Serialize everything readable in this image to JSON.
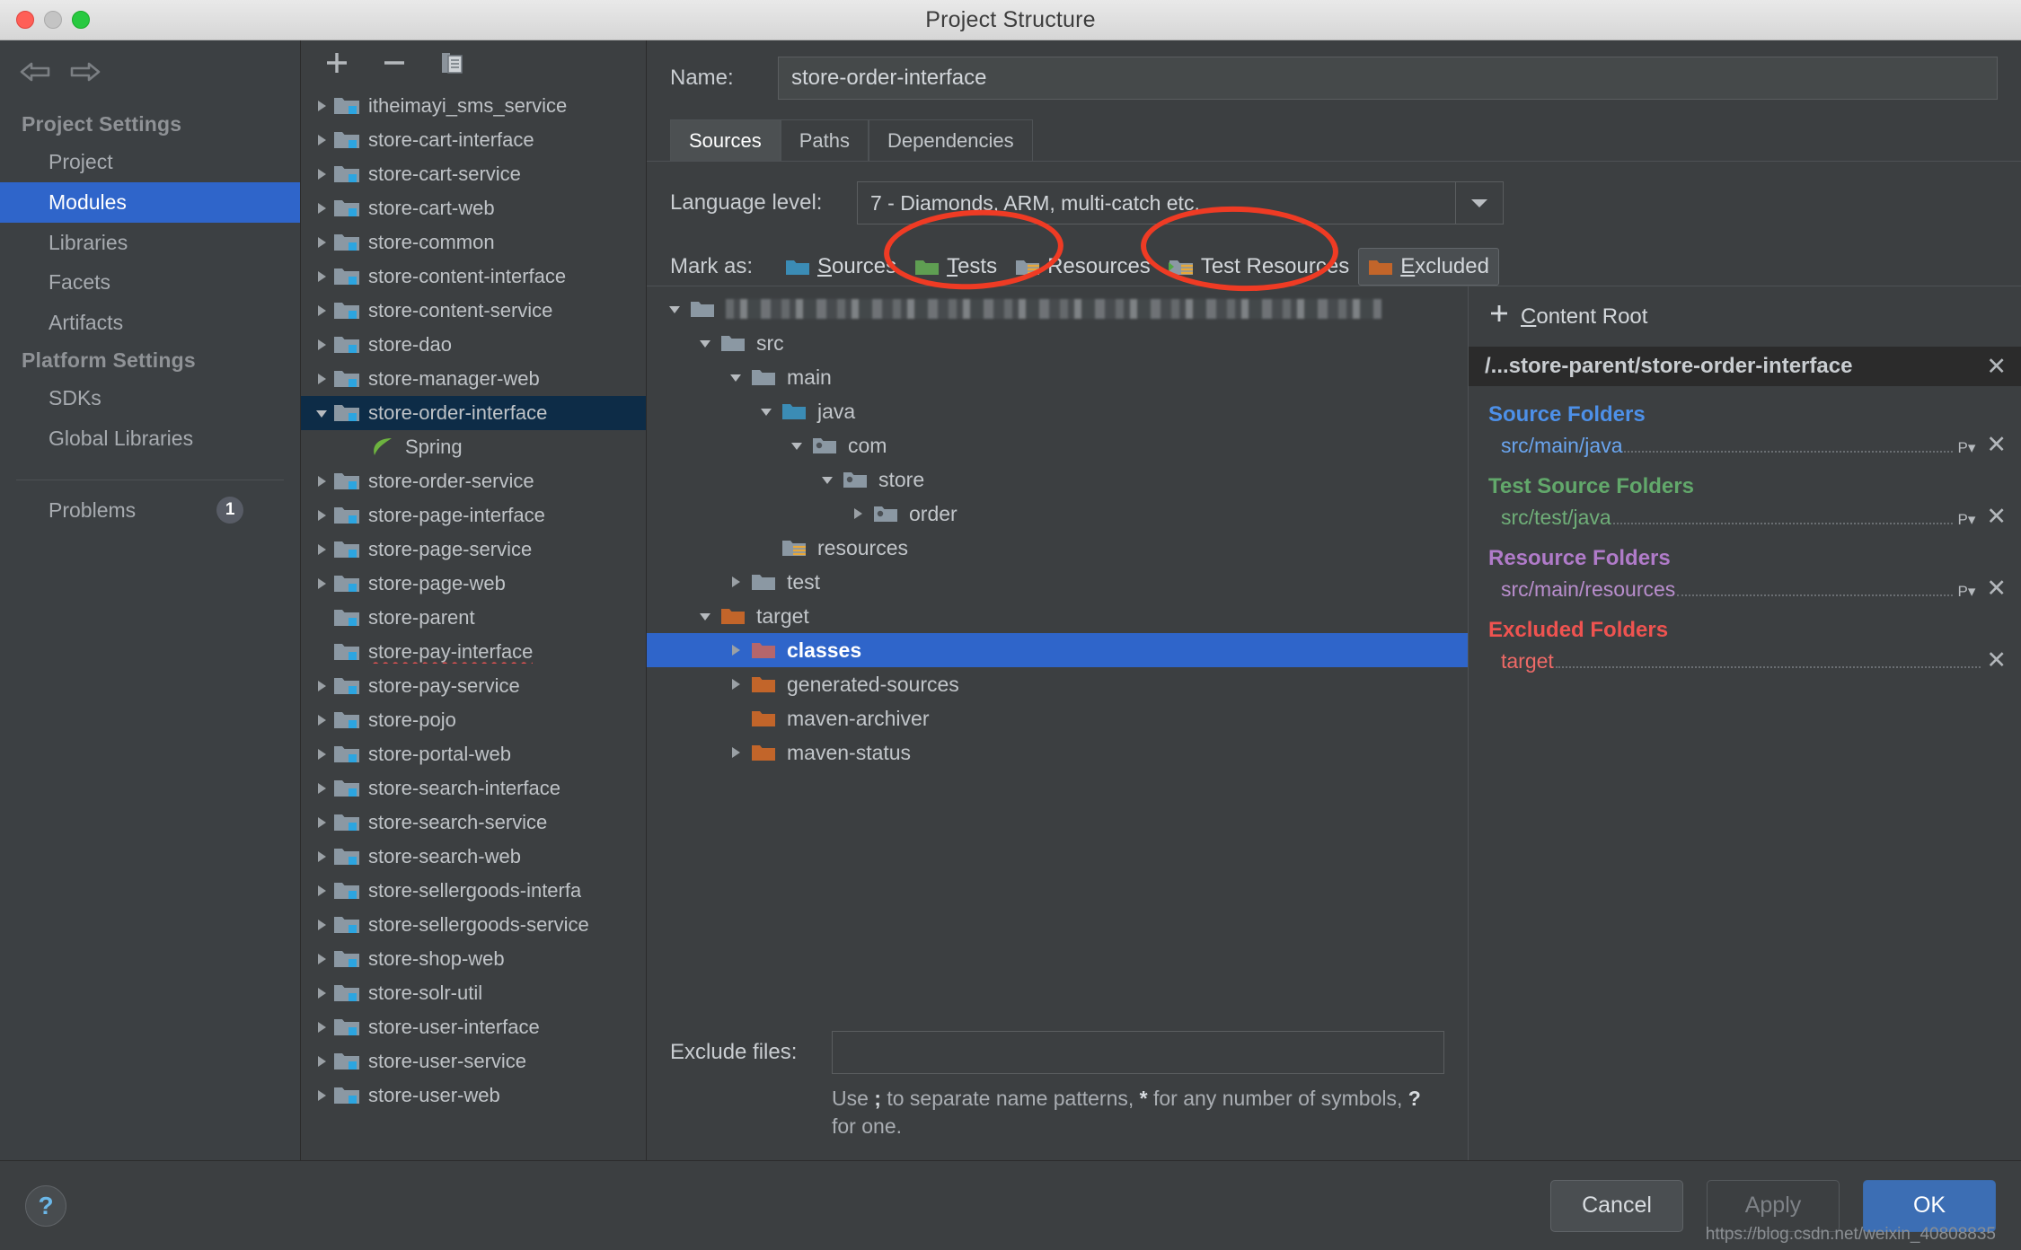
{
  "window": {
    "title": "Project Structure",
    "traffic_lights": [
      "close",
      "minimize",
      "maximize"
    ]
  },
  "sidebar": {
    "nav_back_icon": "arrow-left-icon",
    "nav_forward_icon": "arrow-right-icon",
    "sections": [
      {
        "header": "Project Settings",
        "items": [
          {
            "label": "Project",
            "selected": false
          },
          {
            "label": "Modules",
            "selected": true
          },
          {
            "label": "Libraries",
            "selected": false
          },
          {
            "label": "Facets",
            "selected": false
          },
          {
            "label": "Artifacts",
            "selected": false
          }
        ]
      },
      {
        "header": "Platform Settings",
        "items": [
          {
            "label": "SDKs",
            "selected": false
          },
          {
            "label": "Global Libraries",
            "selected": false
          }
        ]
      }
    ],
    "problems": {
      "label": "Problems",
      "count": "1"
    }
  },
  "modules_panel": {
    "toolbar": [
      {
        "name": "add-module-button",
        "icon": "plus-icon"
      },
      {
        "name": "remove-module-button",
        "icon": "minus-icon"
      },
      {
        "name": "copy-module-button",
        "icon": "copy-icon"
      }
    ],
    "items": [
      {
        "label": "itheimayi_sms_service",
        "expandable": true,
        "expanded": false,
        "selected": false
      },
      {
        "label": "store-cart-interface",
        "expandable": true,
        "expanded": false,
        "selected": false
      },
      {
        "label": "store-cart-service",
        "expandable": true,
        "expanded": false,
        "selected": false
      },
      {
        "label": "store-cart-web",
        "expandable": true,
        "expanded": false,
        "selected": false
      },
      {
        "label": "store-common",
        "expandable": true,
        "expanded": false,
        "selected": false
      },
      {
        "label": "store-content-interface",
        "expandable": true,
        "expanded": false,
        "selected": false
      },
      {
        "label": "store-content-service",
        "expandable": true,
        "expanded": false,
        "selected": false
      },
      {
        "label": "store-dao",
        "expandable": true,
        "expanded": false,
        "selected": false
      },
      {
        "label": "store-manager-web",
        "expandable": true,
        "expanded": false,
        "selected": false
      },
      {
        "label": "store-order-interface",
        "expandable": true,
        "expanded": true,
        "selected": true
      },
      {
        "label": "Spring",
        "facet": true,
        "selected": false
      },
      {
        "label": "store-order-service",
        "expandable": true,
        "expanded": false,
        "selected": false
      },
      {
        "label": "store-page-interface",
        "expandable": true,
        "expanded": false,
        "selected": false
      },
      {
        "label": "store-page-service",
        "expandable": true,
        "expanded": false,
        "selected": false
      },
      {
        "label": "store-page-web",
        "expandable": true,
        "expanded": false,
        "selected": false
      },
      {
        "label": "store-parent",
        "expandable": false,
        "expanded": false,
        "selected": false
      },
      {
        "label": "store-pay-interface",
        "expandable": false,
        "expanded": false,
        "selected": false,
        "error": true
      },
      {
        "label": "store-pay-service",
        "expandable": true,
        "expanded": false,
        "selected": false
      },
      {
        "label": "store-pojo",
        "expandable": true,
        "expanded": false,
        "selected": false
      },
      {
        "label": "store-portal-web",
        "expandable": true,
        "expanded": false,
        "selected": false
      },
      {
        "label": "store-search-interface",
        "expandable": true,
        "expanded": false,
        "selected": false
      },
      {
        "label": "store-search-service",
        "expandable": true,
        "expanded": false,
        "selected": false
      },
      {
        "label": "store-search-web",
        "expandable": true,
        "expanded": false,
        "selected": false
      },
      {
        "label": "store-sellergoods-interfa",
        "expandable": true,
        "expanded": false,
        "selected": false
      },
      {
        "label": "store-sellergoods-service",
        "expandable": true,
        "expanded": false,
        "selected": false
      },
      {
        "label": "store-shop-web",
        "expandable": true,
        "expanded": false,
        "selected": false
      },
      {
        "label": "store-solr-util",
        "expandable": true,
        "expanded": false,
        "selected": false
      },
      {
        "label": "store-user-interface",
        "expandable": true,
        "expanded": false,
        "selected": false
      },
      {
        "label": "store-user-service",
        "expandable": true,
        "expanded": false,
        "selected": false
      },
      {
        "label": "store-user-web",
        "expandable": true,
        "expanded": false,
        "selected": false
      }
    ]
  },
  "detail": {
    "name_label": "Name:",
    "name_value": "store-order-interface",
    "tabs": [
      {
        "label": "Sources",
        "active": true
      },
      {
        "label": "Paths",
        "active": false
      },
      {
        "label": "Dependencies",
        "active": false
      }
    ],
    "language_level_label": "Language level:",
    "language_level_value": "7 - Diamonds, ARM, multi-catch etc.",
    "mark_as_label": "Mark as:",
    "mark_as_buttons": [
      {
        "label": "Sources",
        "mnemonic": "S",
        "color": "#3b8cb5",
        "kind": "sources",
        "highlighted": true
      },
      {
        "label": "Tests",
        "mnemonic": "T",
        "color": "#5f9e52",
        "kind": "tests",
        "highlighted": false
      },
      {
        "label": "Resources",
        "mnemonic": "",
        "color": "#8b98a3",
        "kind": "resources",
        "highlighted": true
      },
      {
        "label": "Test Resources",
        "mnemonic": "",
        "color": "#8b98a3",
        "kind": "test-resources",
        "highlighted": false
      },
      {
        "label": "Excluded",
        "mnemonic": "E",
        "color": "#c2652a",
        "kind": "excluded",
        "boxed": true
      }
    ],
    "tree": [
      {
        "label": "",
        "depth": 0,
        "arrow": "down",
        "folder": "plain",
        "blurred": true
      },
      {
        "label": "src",
        "depth": 1,
        "arrow": "down",
        "folder": "plain"
      },
      {
        "label": "main",
        "depth": 2,
        "arrow": "down",
        "folder": "plain"
      },
      {
        "label": "java",
        "depth": 3,
        "arrow": "down",
        "folder": "source"
      },
      {
        "label": "com",
        "depth": 4,
        "arrow": "down",
        "folder": "package"
      },
      {
        "label": "store",
        "depth": 5,
        "arrow": "down",
        "folder": "package"
      },
      {
        "label": "order",
        "depth": 6,
        "arrow": "right",
        "folder": "package"
      },
      {
        "label": "resources",
        "depth": 3,
        "arrow": "none",
        "folder": "resource"
      },
      {
        "label": "test",
        "depth": 2,
        "arrow": "right",
        "folder": "plain"
      },
      {
        "label": "target",
        "depth": 1,
        "arrow": "down",
        "folder": "excluded"
      },
      {
        "label": "classes",
        "depth": 2,
        "arrow": "right",
        "folder": "excluded-sel",
        "selected": true
      },
      {
        "label": "generated-sources",
        "depth": 2,
        "arrow": "right",
        "folder": "excluded"
      },
      {
        "label": "maven-archiver",
        "depth": 2,
        "arrow": "none",
        "folder": "excluded"
      },
      {
        "label": "maven-status",
        "depth": 2,
        "arrow": "right",
        "folder": "excluded"
      }
    ],
    "exclude_files_label": "Exclude files:",
    "exclude_files_value": "",
    "exclude_hint_parts": [
      "Use ",
      ";",
      " to separate name patterns, ",
      "*",
      " for any number of symbols, ",
      "?",
      " for one."
    ]
  },
  "roots_panel": {
    "add_content_root_label": "Add Content Root",
    "add_content_root_mnemonic": "C",
    "content_root_path": "/...store-parent/store-order-interface",
    "close_icon": "close-icon",
    "groups": [
      {
        "title": "Source Folders",
        "kind": "src",
        "items": [
          {
            "path": "src/main/java",
            "package_prefix_icon": "P",
            "has_close": true
          }
        ]
      },
      {
        "title": "Test Source Folders",
        "kind": "test",
        "items": [
          {
            "path": "src/test/java",
            "package_prefix_icon": "P",
            "has_close": true
          }
        ]
      },
      {
        "title": "Resource Folders",
        "kind": "res",
        "items": [
          {
            "path": "src/main/resources",
            "package_prefix_icon": "P",
            "has_close": true
          }
        ]
      },
      {
        "title": "Excluded Folders",
        "kind": "exc",
        "items": [
          {
            "path": "target",
            "package_prefix_icon": "",
            "has_close": true
          }
        ]
      }
    ]
  },
  "footer": {
    "help_icon": "question-mark-icon",
    "buttons": [
      {
        "label": "Cancel",
        "style": "cancel",
        "enabled": true
      },
      {
        "label": "Apply",
        "style": "apply",
        "enabled": false
      },
      {
        "label": "OK",
        "style": "ok",
        "enabled": true
      }
    ],
    "watermark": "https://blog.csdn.net/weixin_40808835"
  },
  "colors": {
    "accent_blue": "#2f65ca",
    "selection_dark": "#0d2c47",
    "source_blue": "#4d90e8",
    "test_green": "#62a86b",
    "resource_purple": "#b07bc9",
    "excluded_red": "#ef5350",
    "annotation_red": "#ef3b24",
    "window_bg": "#3c3f41"
  }
}
